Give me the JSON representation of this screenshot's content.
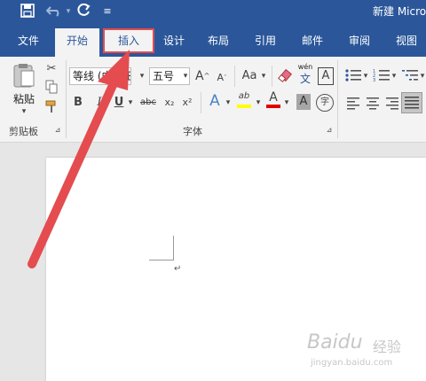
{
  "window": {
    "title": "新建 Micro"
  },
  "quick_access": {
    "save_icon": "save-icon",
    "undo_icon": "undo-icon",
    "redo_icon": "redo-icon",
    "customize_icon": "customize-icon"
  },
  "tabs": [
    {
      "label": "文件"
    },
    {
      "label": "开始"
    },
    {
      "label": "插入"
    },
    {
      "label": "设计"
    },
    {
      "label": "布局"
    },
    {
      "label": "引用"
    },
    {
      "label": "邮件"
    },
    {
      "label": "审阅"
    },
    {
      "label": "视图"
    }
  ],
  "clipboard": {
    "paste_label": "粘贴",
    "group_label": "剪贴板"
  },
  "font": {
    "name_value": "等线 (中文正文",
    "size_value": "五号",
    "aa_label": "Aa",
    "wen_label": "wén",
    "wen_char": "文",
    "a_box": "A",
    "bold": "B",
    "italic": "I",
    "underline": "U",
    "strike": "abc",
    "subscript": "x₂",
    "superscript": "x²",
    "highlight_ab": "ab",
    "font_color_a": "A",
    "shading_a": "A",
    "enclose_char": "字",
    "group_label": "字体"
  },
  "colors": {
    "accent": "#2b579a",
    "highlight": "#e44c4f",
    "font_red": "#e00000",
    "highlight_yellow": "#ffff00"
  },
  "document": {
    "paragraph_mark": "↵"
  },
  "watermark": {
    "brand": "Baidu",
    "brand_cn": "经验",
    "url": "jingyan.baidu.com"
  }
}
